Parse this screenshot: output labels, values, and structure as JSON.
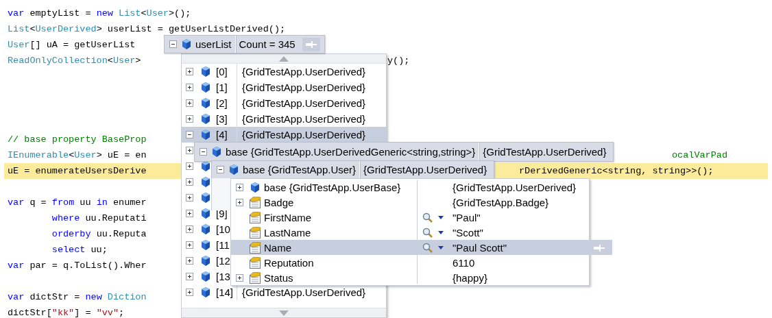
{
  "editor": {
    "lines": [
      {
        "highlighted": false,
        "tokens": [
          {
            "text": "var",
            "kind": "kw"
          },
          {
            "text": " emptyList = ",
            "kind": "plain"
          },
          {
            "text": "new ",
            "kind": "kw"
          },
          {
            "text": "List",
            "kind": "type"
          },
          {
            "text": "<",
            "kind": "plain"
          },
          {
            "text": "User",
            "kind": "type"
          },
          {
            "text": ">();",
            "kind": "plain"
          }
        ]
      },
      {
        "highlighted": false,
        "tokens": [
          {
            "text": "List",
            "kind": "type"
          },
          {
            "text": "<",
            "kind": "plain"
          },
          {
            "text": "UserDerived",
            "kind": "type"
          },
          {
            "text": "> userList = getUserListDerived();",
            "kind": "plain"
          }
        ]
      },
      {
        "highlighted": false,
        "tokens": [
          {
            "text": "User",
            "kind": "type"
          },
          {
            "text": "[] uA = getUserList",
            "kind": "plain"
          }
        ]
      },
      {
        "highlighted": false,
        "tokens": [
          {
            "text": "ReadOnlyCollection",
            "kind": "type"
          },
          {
            "text": "<",
            "kind": "plain"
          },
          {
            "text": "User",
            "kind": "type"
          },
          {
            "text": ">",
            "kind": "plain"
          }
        ],
        "tail": [
          {
            "text": "y();",
            "kind": "plain"
          }
        ]
      },
      {
        "highlighted": false
      },
      {
        "highlighted": false
      },
      {
        "highlighted": false
      },
      {
        "highlighted": false
      },
      {
        "highlighted": false,
        "tokens": [
          {
            "text": "// base property BaseProp",
            "kind": "comment"
          }
        ]
      },
      {
        "highlighted": false,
        "tokens": [
          {
            "text": "IEnumerable",
            "kind": "type"
          },
          {
            "text": "<",
            "kind": "plain"
          },
          {
            "text": "User",
            "kind": "type"
          },
          {
            "text": "> uE = en",
            "kind": "plain"
          }
        ],
        "tail": [
          {
            "text": "ocalVarPad",
            "kind": "comment"
          }
        ]
      },
      {
        "highlighted": true,
        "tokens": [
          {
            "text": "uE = enumerateUsersDerive",
            "kind": "plain"
          }
        ],
        "tail": [
          {
            "text": "rDerivedGeneric<string, string>>();",
            "kind": "plain"
          }
        ]
      },
      {
        "highlighted": false
      },
      {
        "highlighted": false,
        "tokens": [
          {
            "text": "var",
            "kind": "kw"
          },
          {
            "text": " q = ",
            "kind": "plain"
          },
          {
            "text": "from",
            "kind": "kw"
          },
          {
            "text": " uu ",
            "kind": "plain"
          },
          {
            "text": "in",
            "kind": "kw"
          },
          {
            "text": " enumer",
            "kind": "plain"
          }
        ]
      },
      {
        "highlighted": false,
        "tokens": [
          {
            "text": "        where",
            "kind": "kw"
          },
          {
            "text": " uu.Reputati",
            "kind": "plain"
          }
        ]
      },
      {
        "highlighted": false,
        "tokens": [
          {
            "text": "        orderby",
            "kind": "kw"
          },
          {
            "text": " uu.Reputa",
            "kind": "plain"
          }
        ]
      },
      {
        "highlighted": false,
        "tokens": [
          {
            "text": "        select",
            "kind": "kw"
          },
          {
            "text": " uu;",
            "kind": "plain"
          }
        ]
      },
      {
        "highlighted": false,
        "tokens": [
          {
            "text": "var",
            "kind": "kw"
          },
          {
            "text": " par = q.ToList().Wher",
            "kind": "plain"
          }
        ]
      },
      {
        "highlighted": false
      },
      {
        "highlighted": false,
        "tokens": [
          {
            "text": "var",
            "kind": "kw"
          },
          {
            "text": " dictStr = ",
            "kind": "plain"
          },
          {
            "text": "new ",
            "kind": "kw"
          },
          {
            "text": "Diction",
            "kind": "type"
          }
        ]
      },
      {
        "highlighted": false,
        "tokens": [
          {
            "text": "dictStr[",
            "kind": "plain"
          },
          {
            "text": "\"kk\"",
            "kind": "string"
          },
          {
            "text": "] = ",
            "kind": "plain"
          },
          {
            "text": "\"vv\"",
            "kind": "string"
          },
          {
            "text": ";",
            "kind": "plain"
          }
        ]
      }
    ]
  },
  "datatip": {
    "name": "userList",
    "value": "Count = 345",
    "expanded": true,
    "items": [
      {
        "index": "[0]",
        "value": "{GridTestApp.UserDerived}",
        "expanded": false,
        "selected": false
      },
      {
        "index": "[1]",
        "value": "{GridTestApp.UserDerived}",
        "expanded": false,
        "selected": false
      },
      {
        "index": "[2]",
        "value": "{GridTestApp.UserDerived}",
        "expanded": false,
        "selected": false
      },
      {
        "index": "[3]",
        "value": "{GridTestApp.UserDerived}",
        "expanded": false,
        "selected": false
      },
      {
        "index": "[4]",
        "value": "{GridTestApp.UserDerived}",
        "expanded": true,
        "selected": true
      },
      {
        "expanded": false,
        "selected": false
      },
      {
        "expanded": false,
        "selected": false
      },
      {
        "expanded": false,
        "selected": false
      },
      {
        "expanded": false,
        "selected": false
      },
      {
        "index": "[9]",
        "expanded": false,
        "selected": false
      },
      {
        "index": "[10",
        "expanded": false,
        "selected": false
      },
      {
        "index": "[11",
        "expanded": false,
        "selected": false
      },
      {
        "index": "[12",
        "expanded": false,
        "selected": false
      },
      {
        "index": "[13",
        "expanded": false,
        "selected": false
      },
      {
        "index": "[14]",
        "value": "{GridTestApp.UserDerived}",
        "expanded": false,
        "selected": false
      }
    ]
  },
  "base_tips": [
    {
      "name": "base {GridTestApp.UserDerivedGeneric<string,string>}",
      "value": "{GridTestApp.UserDerived}",
      "expanded": true
    },
    {
      "name": "base {GridTestApp.User}",
      "value": "{GridTestApp.UserDerived}",
      "expanded": true
    }
  ],
  "members": [
    {
      "kind": "object",
      "name": "base {GridTestApp.UserBase}",
      "value": "{GridTestApp.UserDerived}",
      "expandable": true,
      "visualizer": false,
      "selected": false
    },
    {
      "kind": "property",
      "name": "Badge",
      "value": "{GridTestApp.Badge}",
      "expandable": true,
      "visualizer": false,
      "selected": false
    },
    {
      "kind": "property",
      "name": "FirstName",
      "value": "\"Paul\"",
      "expandable": false,
      "visualizer": true,
      "selected": false
    },
    {
      "kind": "property",
      "name": "LastName",
      "value": "\"Scott\"",
      "expandable": false,
      "visualizer": true,
      "selected": false
    },
    {
      "kind": "property",
      "name": "Name",
      "value": "\"Paul Scott\"",
      "expandable": false,
      "visualizer": true,
      "selected": true
    },
    {
      "kind": "property",
      "name": "Reputation",
      "value": "6110",
      "expandable": false,
      "visualizer": false,
      "selected": false
    },
    {
      "kind": "property",
      "name": "Status",
      "value": "{happy}",
      "expandable": true,
      "visualizer": false,
      "selected": false
    }
  ]
}
